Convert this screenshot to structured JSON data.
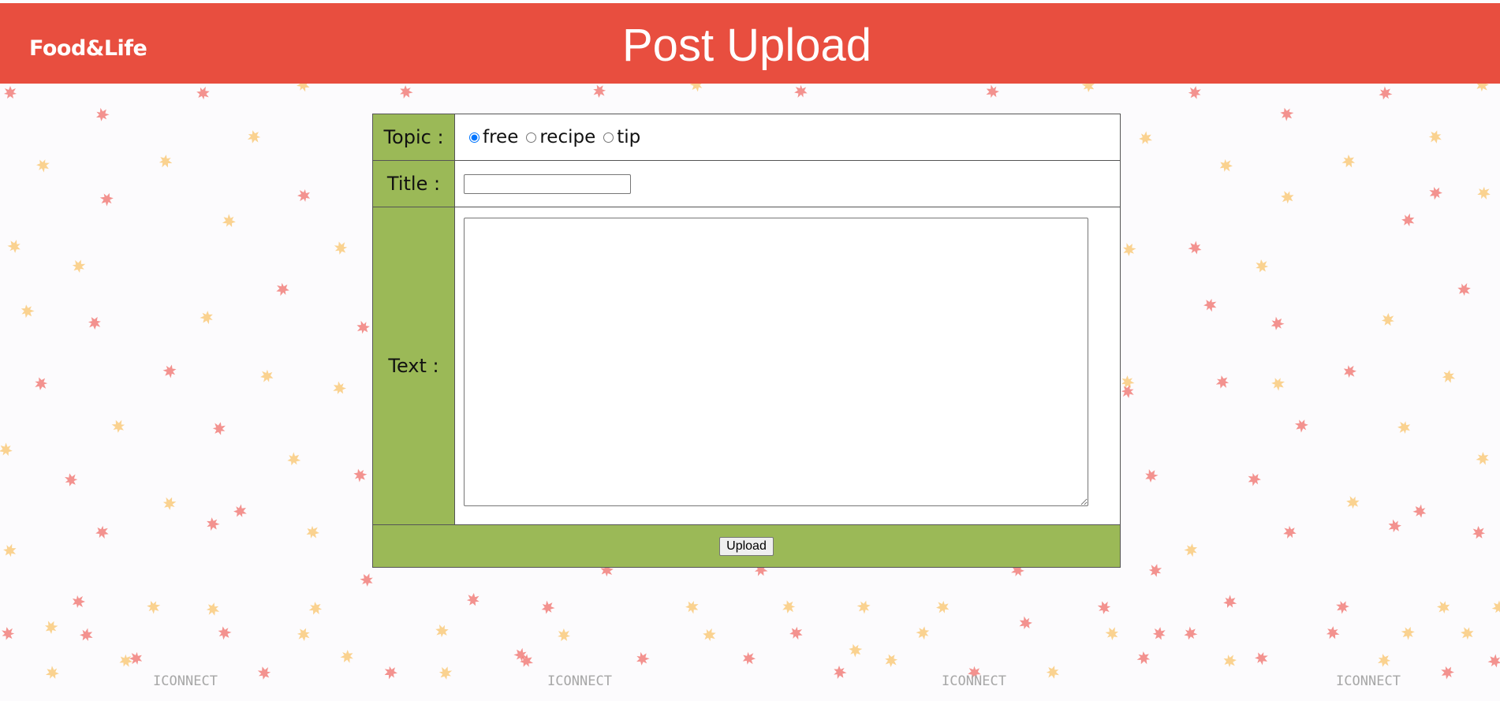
{
  "header": {
    "brand": "Food&Life",
    "title": "Post Upload"
  },
  "form": {
    "topic_label": "Topic :",
    "topic_options": [
      {
        "label": "free",
        "checked": true
      },
      {
        "label": "recipe",
        "checked": false
      },
      {
        "label": "tip",
        "checked": false
      }
    ],
    "title_label": "Title :",
    "title_value": "",
    "text_label": "Text :",
    "text_value": "",
    "submit_label": "Upload"
  },
  "watermark": {
    "text": "ICONNECT"
  },
  "colors": {
    "header_bg": "#e84e3f",
    "label_bg": "#9bb957",
    "leaf_red": "#f06f69",
    "leaf_yellow": "#f9c46b",
    "page_bg": "#fcfbfd"
  }
}
